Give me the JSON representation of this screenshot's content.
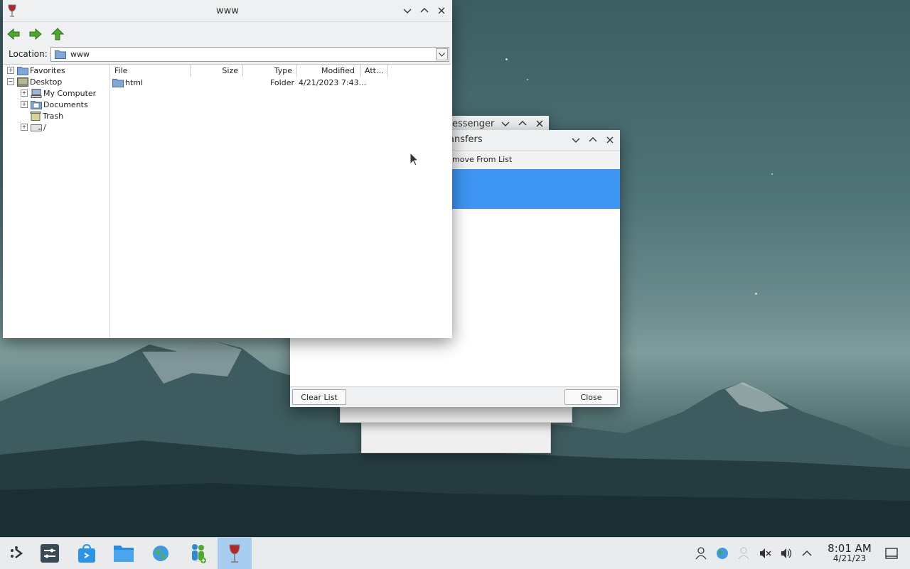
{
  "file_manager": {
    "title": "www",
    "location_label": "Location:",
    "location_value": "www",
    "tree": [
      "Favorites",
      "Desktop",
      "My Computer",
      "Documents",
      "Trash",
      "/"
    ],
    "columns": [
      "File",
      "Size",
      "Type",
      "Modified",
      "Att..."
    ],
    "rows": [
      {
        "name": "html",
        "size": "",
        "type": "Folder",
        "modified": "4/21/2023 7:43...",
        "attr": ""
      }
    ]
  },
  "messenger": {
    "title_fragment": "essenger"
  },
  "transfers": {
    "title_fragment": "ansfers",
    "menu_fragment": "move From List",
    "clear_label": "Clear List",
    "close_label": "Close"
  },
  "taskbar": {
    "time": "8:01 AM",
    "date": "4/21/23",
    "apps": [
      "application-launcher-icon",
      "system-settings-icon",
      "discover-store-icon",
      "file-manager-icon",
      "web-browser-icon",
      "messenger-icon",
      "wine-icon"
    ],
    "tray": [
      "user-icon",
      "network-globe-icon",
      "people-icon",
      "mute-icon",
      "volume-icon",
      "expand-tray-icon",
      "show-desktop-icon"
    ]
  },
  "colors": {
    "selection": "#3d94f2",
    "active_task": "#a7cdf0"
  }
}
